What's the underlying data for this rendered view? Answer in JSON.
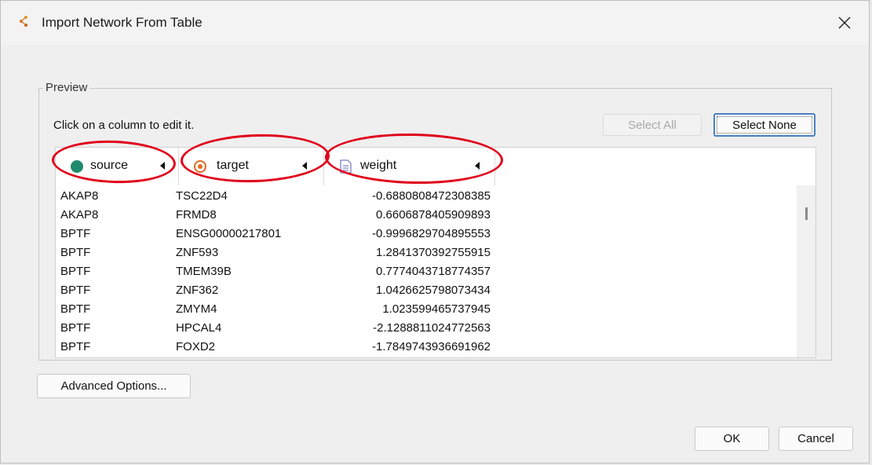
{
  "window": {
    "title": "Import Network From Table"
  },
  "preview": {
    "legend": "Preview",
    "hint": "Click on a column to edit it.",
    "select_all": "Select All",
    "select_none": "Select None"
  },
  "columns": [
    {
      "label": "source",
      "icon": "source-node-icon"
    },
    {
      "label": "target",
      "icon": "target-node-icon"
    },
    {
      "label": "weight",
      "icon": "edge-attribute-icon"
    }
  ],
  "rows": [
    {
      "source": "AKAP8",
      "target": "TSC22D4",
      "weight": "-0.6880808472308385"
    },
    {
      "source": "AKAP8",
      "target": "FRMD8",
      "weight": "0.6606878405909893"
    },
    {
      "source": "BPTF",
      "target": "ENSG00000217801",
      "weight": "-0.9996829704895553"
    },
    {
      "source": "BPTF",
      "target": "ZNF593",
      "weight": "1.2841370392755915"
    },
    {
      "source": "BPTF",
      "target": "TMEM39B",
      "weight": "0.7774043718774357"
    },
    {
      "source": "BPTF",
      "target": "ZNF362",
      "weight": "1.0426625798073434"
    },
    {
      "source": "BPTF",
      "target": "ZMYM4",
      "weight": "1.023599465737945"
    },
    {
      "source": "BPTF",
      "target": "HPCAL4",
      "weight": "-2.1288811024772563"
    },
    {
      "source": "BPTF",
      "target": "FOXD2",
      "weight": "-1.7849743936691962"
    }
  ],
  "buttons": {
    "advanced": "Advanced Options...",
    "ok": "OK",
    "cancel": "Cancel"
  },
  "colors": {
    "source_icon": "#1e8a6e",
    "target_icon": "#e06a1f",
    "weight_icon": "#7b7fc8",
    "annotation": "#e0001b",
    "focus": "#4a7fc4"
  }
}
